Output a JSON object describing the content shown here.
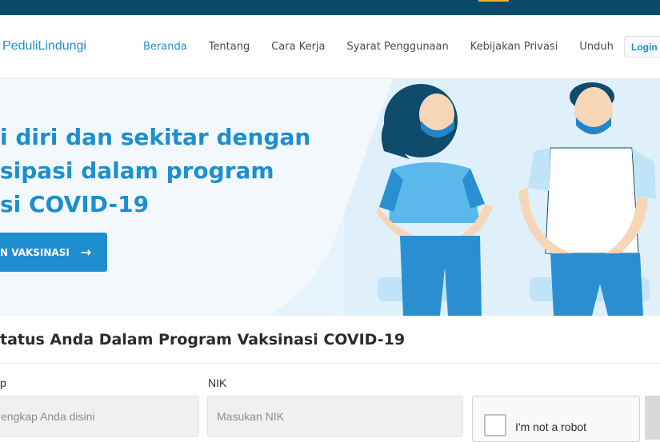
{
  "header": {
    "brand": "PeduliLindungi",
    "nav": [
      {
        "label": "Beranda",
        "active": true
      },
      {
        "label": "Tentang"
      },
      {
        "label": "Cara Kerja"
      },
      {
        "label": "Syarat Penggunaan"
      },
      {
        "label": "Kebijakan Privasi"
      },
      {
        "label": "Unduh"
      }
    ],
    "login": "Login /"
  },
  "hero": {
    "lines": [
      "i diri dan sekitar dengan",
      "sipasi dalam program",
      "si COVID-19"
    ],
    "cta": "N VAKSINASI"
  },
  "form": {
    "title": "tatus Anda Dalam Program Vaksinasi COVID-19",
    "name_label": "p",
    "name_placeholder": "engkap Anda disini",
    "nik_label": "NIK",
    "nik_placeholder": "Masukan NIK",
    "captcha": "I'm not a robot"
  },
  "colors": {
    "primary": "#1c8fce",
    "topbar": "#0b4a6b"
  }
}
